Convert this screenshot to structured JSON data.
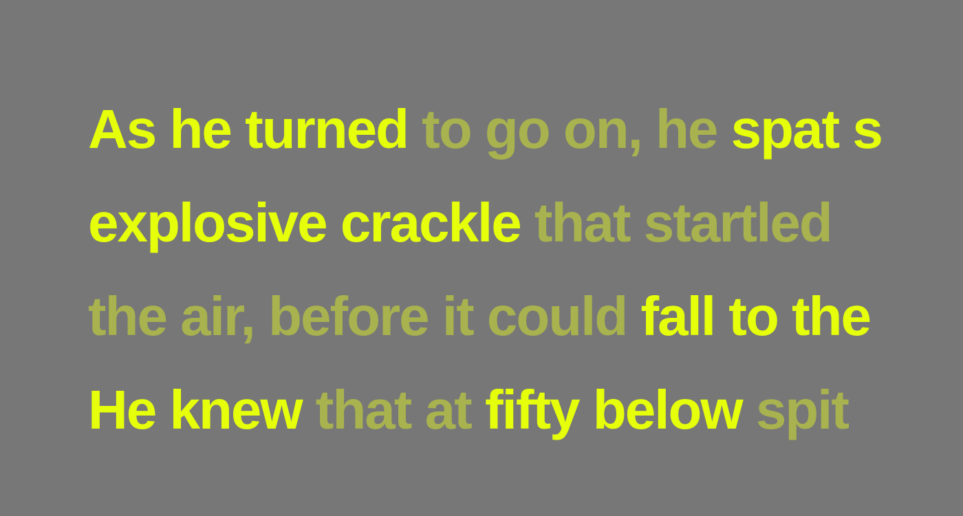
{
  "colors": {
    "background": "#777777",
    "bright": "#e6ff0a",
    "dim": "#a8b24e"
  },
  "lines": [
    {
      "segments": [
        {
          "text": "As he turned ",
          "style": "bright"
        },
        {
          "text": "to go on, he ",
          "style": "dim"
        },
        {
          "text": "spat s",
          "style": "bright"
        }
      ]
    },
    {
      "segments": [
        {
          "text": "explosive crackle ",
          "style": "bright"
        },
        {
          "text": "that startled",
          "style": "dim"
        }
      ]
    },
    {
      "segments": [
        {
          "text": "the air, before it could ",
          "style": "dim"
        },
        {
          "text": "fall to the",
          "style": "bright"
        }
      ]
    },
    {
      "segments": [
        {
          "text": "He knew ",
          "style": "bright"
        },
        {
          "text": "that at ",
          "style": "dim"
        },
        {
          "text": "fifty below ",
          "style": "bright"
        },
        {
          "text": "spit",
          "style": "dim"
        }
      ]
    }
  ]
}
